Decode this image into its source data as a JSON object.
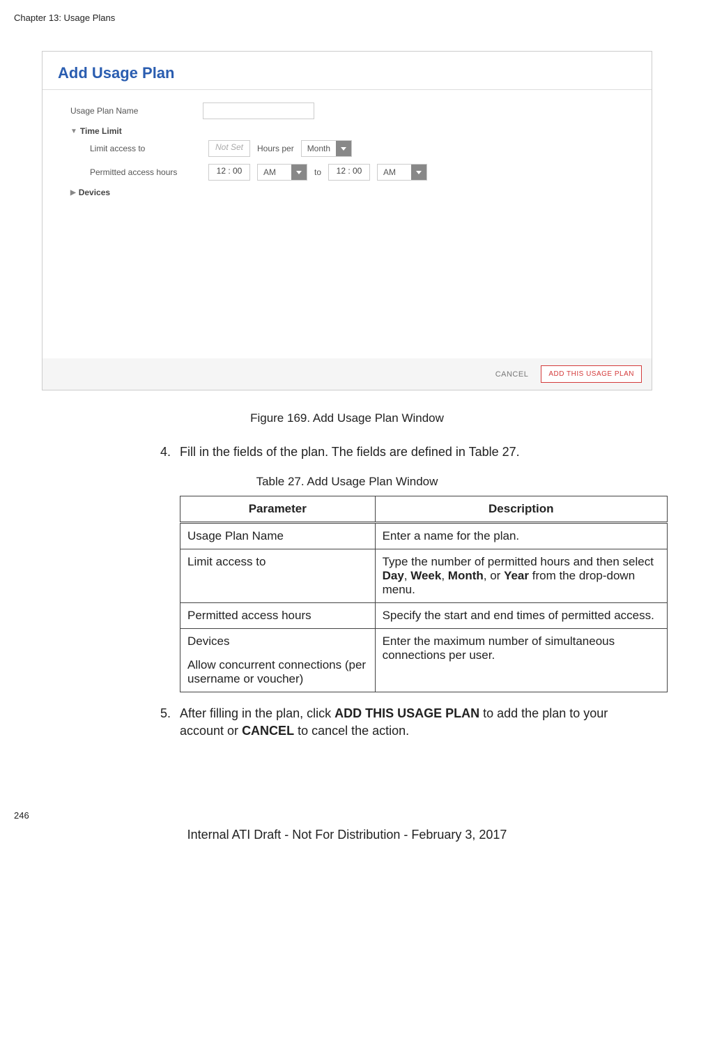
{
  "page": {
    "chapter_header": "Chapter 13: Usage Plans",
    "page_number": "246",
    "footer": "Internal ATI Draft - Not For Distribution - February 3, 2017"
  },
  "dialog": {
    "title": "Add Usage Plan",
    "labels": {
      "usage_plan_name": "Usage Plan Name",
      "time_limit": "Time Limit",
      "limit_access_to": "Limit access to",
      "permitted_access_hours": "Permitted access hours",
      "devices": "Devices",
      "hours_per": "Hours per",
      "to": "to"
    },
    "fields": {
      "plan_name_value": "",
      "limit_not_set": "Not Set",
      "period_selected": "Month",
      "start_time": "12 : 00",
      "start_ampm": "AM",
      "end_time": "12 : 00",
      "end_ampm": "AM"
    },
    "footer": {
      "cancel": "CANCEL",
      "add": "ADD THIS USAGE PLAN"
    }
  },
  "content": {
    "figure_caption": "Figure 169. Add Usage Plan Window",
    "step4_num": "4.",
    "step4_text": "Fill in the fields of the plan. The fields are defined in Table 27.",
    "table_caption": "Table 27. Add Usage Plan Window",
    "table": {
      "headers": {
        "param": "Parameter",
        "desc": "Description"
      },
      "rows": [
        {
          "param": "Usage Plan Name",
          "desc_parts": [
            "Enter a name for the plan."
          ]
        },
        {
          "param": "Limit access to",
          "desc_parts": [
            "Type the number of permitted hours and then select ",
            "Day",
            ", ",
            "Week",
            ", ",
            "Month",
            ", or ",
            "Year",
            " from the drop-down menu."
          ]
        },
        {
          "param": "Permitted access hours",
          "desc_parts": [
            "Specify the start and end times of permitted access."
          ]
        },
        {
          "param_main": "Devices",
          "param_sub": "Allow concurrent connections (per username or voucher)",
          "desc_parts": [
            "Enter the maximum number of simultaneous connections per user."
          ]
        }
      ]
    },
    "step5_num": "5.",
    "step5_parts": [
      "After filling in the plan, click ",
      "ADD THIS USAGE PLAN",
      " to add the plan to your account or ",
      "CANCEL",
      " to cancel the action."
    ]
  }
}
